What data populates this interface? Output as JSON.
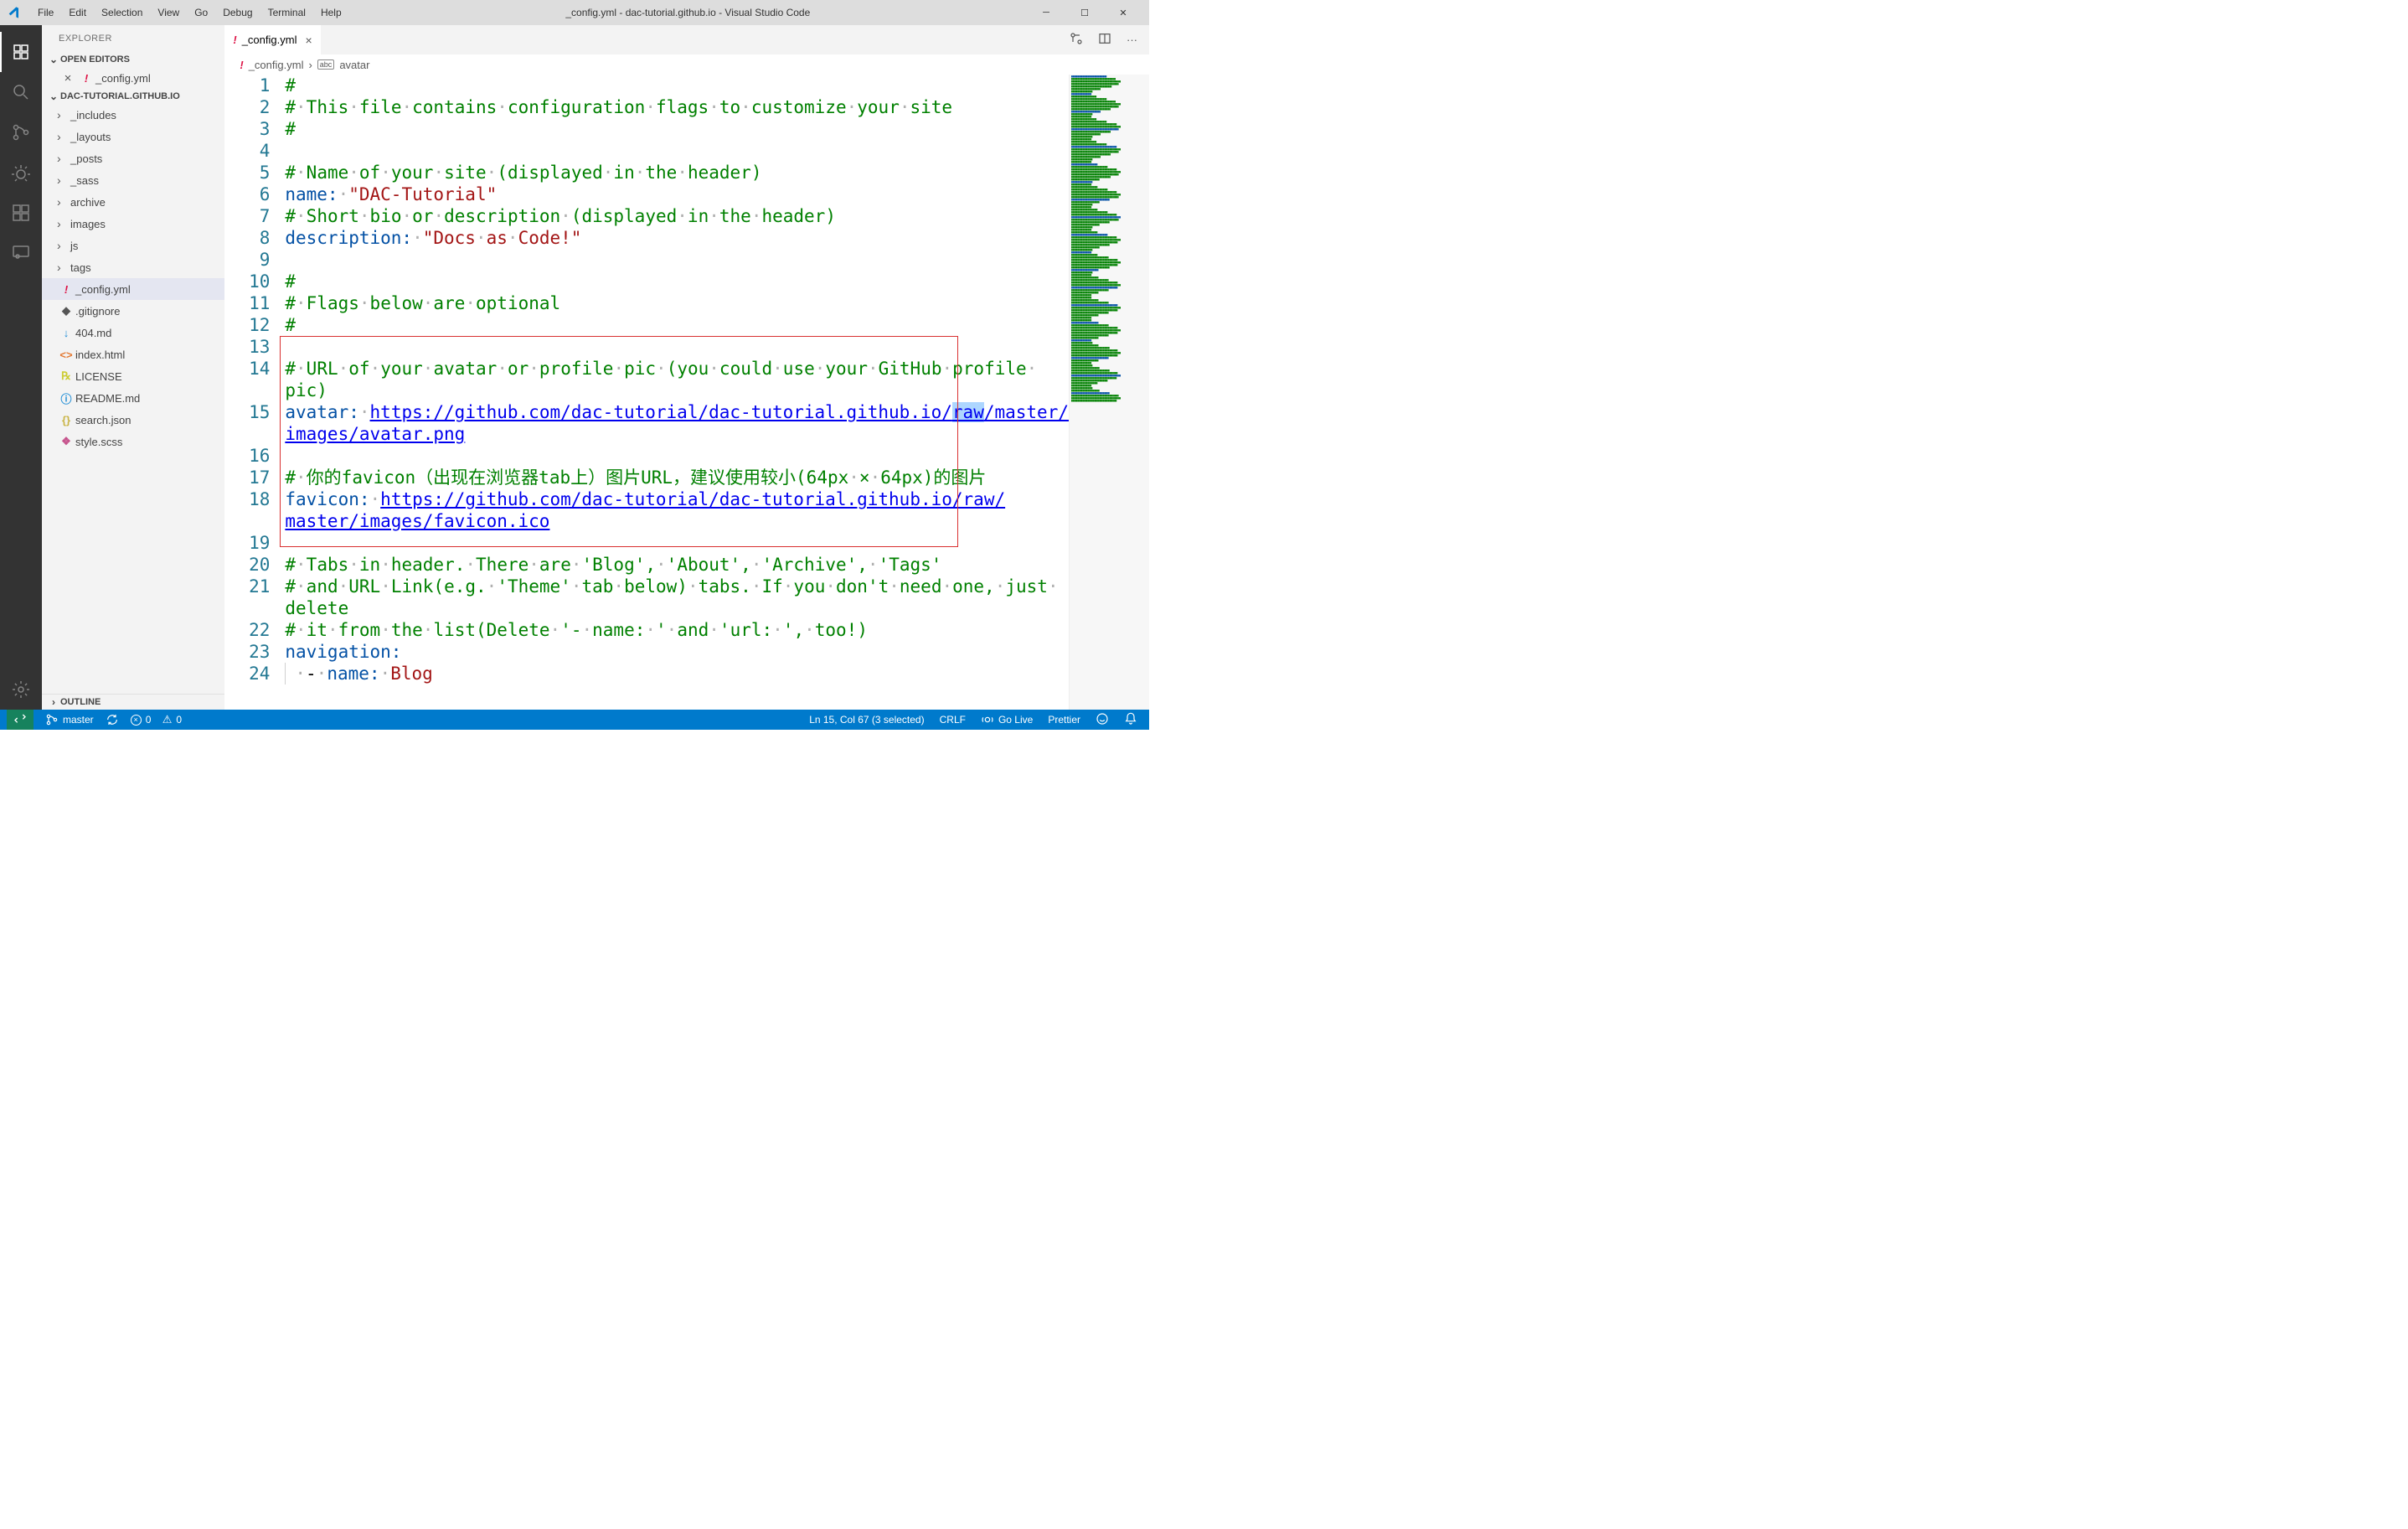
{
  "titlebar": {
    "menus": [
      "File",
      "Edit",
      "Selection",
      "View",
      "Go",
      "Debug",
      "Terminal",
      "Help"
    ],
    "title": "_config.yml - dac-tutorial.github.io - Visual Studio Code"
  },
  "sidebar": {
    "title": "EXPLORER",
    "open_editors_label": "OPEN EDITORS",
    "open_editors": [
      {
        "name": "_config.yml"
      }
    ],
    "workspace_label": "DAC-TUTORIAL.GITHUB.IO",
    "folders": [
      "_includes",
      "_layouts",
      "_posts",
      "_sass",
      "archive",
      "images",
      "js",
      "tags"
    ],
    "files": [
      {
        "name": "_config.yml",
        "icon": "!",
        "color": "#d14",
        "selected": true
      },
      {
        "name": ".gitignore",
        "icon": "◆",
        "color": "#555"
      },
      {
        "name": "404.md",
        "icon": "↓",
        "color": "#1f8dd6"
      },
      {
        "name": "index.html",
        "icon": "<>",
        "color": "#e37933"
      },
      {
        "name": "LICENSE",
        "icon": "℞",
        "color": "#cccc33"
      },
      {
        "name": "README.md",
        "icon": "ⓘ",
        "color": "#1f8dd6"
      },
      {
        "name": "search.json",
        "icon": "{}",
        "color": "#c9b445"
      },
      {
        "name": "style.scss",
        "icon": "❖",
        "color": "#c6538c"
      }
    ],
    "outline_label": "OUTLINE"
  },
  "tab": {
    "name": "_config.yml"
  },
  "breadcrumb": {
    "file": "_config.yml",
    "symbol": "avatar"
  },
  "code": {
    "lines": [
      {
        "n": 1,
        "spans": [
          {
            "c": "cm-comment",
            "t": "#"
          }
        ]
      },
      {
        "n": 2,
        "spans": [
          {
            "c": "cm-comment",
            "t": "#"
          },
          {
            "c": "cm-ws",
            "t": "·"
          },
          {
            "c": "cm-comment",
            "t": "This"
          },
          {
            "c": "cm-ws",
            "t": "·"
          },
          {
            "c": "cm-comment",
            "t": "file"
          },
          {
            "c": "cm-ws",
            "t": "·"
          },
          {
            "c": "cm-comment",
            "t": "contains"
          },
          {
            "c": "cm-ws",
            "t": "·"
          },
          {
            "c": "cm-comment",
            "t": "configuration"
          },
          {
            "c": "cm-ws",
            "t": "·"
          },
          {
            "c": "cm-comment",
            "t": "flags"
          },
          {
            "c": "cm-ws",
            "t": "·"
          },
          {
            "c": "cm-comment",
            "t": "to"
          },
          {
            "c": "cm-ws",
            "t": "·"
          },
          {
            "c": "cm-comment",
            "t": "customize"
          },
          {
            "c": "cm-ws",
            "t": "·"
          },
          {
            "c": "cm-comment",
            "t": "your"
          },
          {
            "c": "cm-ws",
            "t": "·"
          },
          {
            "c": "cm-comment",
            "t": "site"
          }
        ]
      },
      {
        "n": 3,
        "spans": [
          {
            "c": "cm-comment",
            "t": "#"
          }
        ]
      },
      {
        "n": 4,
        "spans": []
      },
      {
        "n": 5,
        "spans": [
          {
            "c": "cm-comment",
            "t": "#"
          },
          {
            "c": "cm-ws",
            "t": "·"
          },
          {
            "c": "cm-comment",
            "t": "Name"
          },
          {
            "c": "cm-ws",
            "t": "·"
          },
          {
            "c": "cm-comment",
            "t": "of"
          },
          {
            "c": "cm-ws",
            "t": "·"
          },
          {
            "c": "cm-comment",
            "t": "your"
          },
          {
            "c": "cm-ws",
            "t": "·"
          },
          {
            "c": "cm-comment",
            "t": "site"
          },
          {
            "c": "cm-ws",
            "t": "·"
          },
          {
            "c": "cm-comment",
            "t": "(displayed"
          },
          {
            "c": "cm-ws",
            "t": "·"
          },
          {
            "c": "cm-comment",
            "t": "in"
          },
          {
            "c": "cm-ws",
            "t": "·"
          },
          {
            "c": "cm-comment",
            "t": "the"
          },
          {
            "c": "cm-ws",
            "t": "·"
          },
          {
            "c": "cm-comment",
            "t": "header)"
          }
        ]
      },
      {
        "n": 6,
        "spans": [
          {
            "c": "cm-key",
            "t": "name:"
          },
          {
            "c": "cm-ws",
            "t": "·"
          },
          {
            "c": "cm-str",
            "t": "\"DAC-Tutorial\""
          }
        ]
      },
      {
        "n": 7,
        "spans": [
          {
            "c": "cm-comment",
            "t": "#"
          },
          {
            "c": "cm-ws",
            "t": "·"
          },
          {
            "c": "cm-comment",
            "t": "Short"
          },
          {
            "c": "cm-ws",
            "t": "·"
          },
          {
            "c": "cm-comment",
            "t": "bio"
          },
          {
            "c": "cm-ws",
            "t": "·"
          },
          {
            "c": "cm-comment",
            "t": "or"
          },
          {
            "c": "cm-ws",
            "t": "·"
          },
          {
            "c": "cm-comment",
            "t": "description"
          },
          {
            "c": "cm-ws",
            "t": "·"
          },
          {
            "c": "cm-comment",
            "t": "(displayed"
          },
          {
            "c": "cm-ws",
            "t": "·"
          },
          {
            "c": "cm-comment",
            "t": "in"
          },
          {
            "c": "cm-ws",
            "t": "·"
          },
          {
            "c": "cm-comment",
            "t": "the"
          },
          {
            "c": "cm-ws",
            "t": "·"
          },
          {
            "c": "cm-comment",
            "t": "header)"
          }
        ]
      },
      {
        "n": 8,
        "spans": [
          {
            "c": "cm-key",
            "t": "description:"
          },
          {
            "c": "cm-ws",
            "t": "·"
          },
          {
            "c": "cm-str",
            "t": "\"Docs"
          },
          {
            "c": "cm-ws",
            "t": "·"
          },
          {
            "c": "cm-str",
            "t": "as"
          },
          {
            "c": "cm-ws",
            "t": "·"
          },
          {
            "c": "cm-str",
            "t": "Code!\""
          }
        ]
      },
      {
        "n": 9,
        "spans": []
      },
      {
        "n": 10,
        "spans": [
          {
            "c": "cm-comment",
            "t": "#"
          }
        ]
      },
      {
        "n": 11,
        "spans": [
          {
            "c": "cm-comment",
            "t": "#"
          },
          {
            "c": "cm-ws",
            "t": "·"
          },
          {
            "c": "cm-comment",
            "t": "Flags"
          },
          {
            "c": "cm-ws",
            "t": "·"
          },
          {
            "c": "cm-comment",
            "t": "below"
          },
          {
            "c": "cm-ws",
            "t": "·"
          },
          {
            "c": "cm-comment",
            "t": "are"
          },
          {
            "c": "cm-ws",
            "t": "·"
          },
          {
            "c": "cm-comment",
            "t": "optional"
          }
        ]
      },
      {
        "n": 12,
        "spans": [
          {
            "c": "cm-comment",
            "t": "#"
          }
        ]
      },
      {
        "n": 13,
        "spans": []
      },
      {
        "n": 14,
        "spans": [
          {
            "c": "cm-comment",
            "t": "#"
          },
          {
            "c": "cm-ws",
            "t": "·"
          },
          {
            "c": "cm-comment",
            "t": "URL"
          },
          {
            "c": "cm-ws",
            "t": "·"
          },
          {
            "c": "cm-comment",
            "t": "of"
          },
          {
            "c": "cm-ws",
            "t": "·"
          },
          {
            "c": "cm-comment",
            "t": "your"
          },
          {
            "c": "cm-ws",
            "t": "·"
          },
          {
            "c": "cm-comment",
            "t": "avatar"
          },
          {
            "c": "cm-ws",
            "t": "·"
          },
          {
            "c": "cm-comment",
            "t": "or"
          },
          {
            "c": "cm-ws",
            "t": "·"
          },
          {
            "c": "cm-comment",
            "t": "profile"
          },
          {
            "c": "cm-ws",
            "t": "·"
          },
          {
            "c": "cm-comment",
            "t": "pic"
          },
          {
            "c": "cm-ws",
            "t": "·"
          },
          {
            "c": "cm-comment",
            "t": "(you"
          },
          {
            "c": "cm-ws",
            "t": "·"
          },
          {
            "c": "cm-comment",
            "t": "could"
          },
          {
            "c": "cm-ws",
            "t": "·"
          },
          {
            "c": "cm-comment",
            "t": "use"
          },
          {
            "c": "cm-ws",
            "t": "·"
          },
          {
            "c": "cm-comment",
            "t": "your"
          },
          {
            "c": "cm-ws",
            "t": "·"
          },
          {
            "c": "cm-comment",
            "t": "GitHub"
          },
          {
            "c": "cm-ws",
            "t": "·"
          },
          {
            "c": "cm-comment",
            "t": "profile"
          },
          {
            "c": "cm-ws",
            "t": "·"
          }
        ]
      },
      {
        "n": "",
        "spans": [
          {
            "c": "cm-comment",
            "t": "pic)"
          }
        ]
      },
      {
        "n": 15,
        "spans": [
          {
            "c": "cm-key",
            "t": "avatar:"
          },
          {
            "c": "cm-ws",
            "t": "·"
          },
          {
            "c": "cm-link",
            "t": "https://github.com/dac-tutorial/dac-tutorial.github.io/"
          },
          {
            "c": "cm-link cm-sel",
            "t": "raw"
          },
          {
            "c": "cm-link",
            "t": "/master/"
          }
        ]
      },
      {
        "n": "",
        "spans": [
          {
            "c": "cm-link",
            "t": "images/avatar.png"
          }
        ]
      },
      {
        "n": 16,
        "spans": []
      },
      {
        "n": 17,
        "spans": [
          {
            "c": "cm-comment",
            "t": "#"
          },
          {
            "c": "cm-ws",
            "t": "·"
          },
          {
            "c": "cm-comment",
            "t": "你的favicon（出现在浏览器tab上）图片URL，建议使用较小(64px"
          },
          {
            "c": "cm-ws",
            "t": "·"
          },
          {
            "c": "cm-comment",
            "t": "×"
          },
          {
            "c": "cm-ws",
            "t": "·"
          },
          {
            "c": "cm-comment",
            "t": "64px)的图片"
          }
        ]
      },
      {
        "n": 18,
        "spans": [
          {
            "c": "cm-key",
            "t": "favicon:"
          },
          {
            "c": "cm-ws",
            "t": "·"
          },
          {
            "c": "cm-link",
            "t": "https://github.com/dac-tutorial/dac-tutorial.github.io/raw/"
          }
        ]
      },
      {
        "n": "",
        "spans": [
          {
            "c": "cm-link",
            "t": "master/images/favicon.ico"
          }
        ]
      },
      {
        "n": 19,
        "spans": []
      },
      {
        "n": 20,
        "spans": [
          {
            "c": "cm-comment",
            "t": "#"
          },
          {
            "c": "cm-ws",
            "t": "·"
          },
          {
            "c": "cm-comment",
            "t": "Tabs"
          },
          {
            "c": "cm-ws",
            "t": "·"
          },
          {
            "c": "cm-comment",
            "t": "in"
          },
          {
            "c": "cm-ws",
            "t": "·"
          },
          {
            "c": "cm-comment",
            "t": "header."
          },
          {
            "c": "cm-ws",
            "t": "·"
          },
          {
            "c": "cm-comment",
            "t": "There"
          },
          {
            "c": "cm-ws",
            "t": "·"
          },
          {
            "c": "cm-comment",
            "t": "are"
          },
          {
            "c": "cm-ws",
            "t": "·"
          },
          {
            "c": "cm-comment",
            "t": "'Blog',"
          },
          {
            "c": "cm-ws",
            "t": "·"
          },
          {
            "c": "cm-comment",
            "t": "'About',"
          },
          {
            "c": "cm-ws",
            "t": "·"
          },
          {
            "c": "cm-comment",
            "t": "'Archive',"
          },
          {
            "c": "cm-ws",
            "t": "·"
          },
          {
            "c": "cm-comment",
            "t": "'Tags'"
          }
        ]
      },
      {
        "n": 21,
        "spans": [
          {
            "c": "cm-comment",
            "t": "#"
          },
          {
            "c": "cm-ws",
            "t": "·"
          },
          {
            "c": "cm-comment",
            "t": "and"
          },
          {
            "c": "cm-ws",
            "t": "·"
          },
          {
            "c": "cm-comment",
            "t": "URL"
          },
          {
            "c": "cm-ws",
            "t": "·"
          },
          {
            "c": "cm-comment",
            "t": "Link(e.g."
          },
          {
            "c": "cm-ws",
            "t": "·"
          },
          {
            "c": "cm-comment",
            "t": "'Theme'"
          },
          {
            "c": "cm-ws",
            "t": "·"
          },
          {
            "c": "cm-comment",
            "t": "tab"
          },
          {
            "c": "cm-ws",
            "t": "·"
          },
          {
            "c": "cm-comment",
            "t": "below)"
          },
          {
            "c": "cm-ws",
            "t": "·"
          },
          {
            "c": "cm-comment",
            "t": "tabs."
          },
          {
            "c": "cm-ws",
            "t": "·"
          },
          {
            "c": "cm-comment",
            "t": "If"
          },
          {
            "c": "cm-ws",
            "t": "·"
          },
          {
            "c": "cm-comment",
            "t": "you"
          },
          {
            "c": "cm-ws",
            "t": "·"
          },
          {
            "c": "cm-comment",
            "t": "don't"
          },
          {
            "c": "cm-ws",
            "t": "·"
          },
          {
            "c": "cm-comment",
            "t": "need"
          },
          {
            "c": "cm-ws",
            "t": "·"
          },
          {
            "c": "cm-comment",
            "t": "one,"
          },
          {
            "c": "cm-ws",
            "t": "·"
          },
          {
            "c": "cm-comment",
            "t": "just"
          },
          {
            "c": "cm-ws",
            "t": "·"
          }
        ]
      },
      {
        "n": "",
        "spans": [
          {
            "c": "cm-comment",
            "t": "delete"
          }
        ]
      },
      {
        "n": 22,
        "spans": [
          {
            "c": "cm-comment",
            "t": "#"
          },
          {
            "c": "cm-ws",
            "t": "·"
          },
          {
            "c": "cm-comment",
            "t": "it"
          },
          {
            "c": "cm-ws",
            "t": "·"
          },
          {
            "c": "cm-comment",
            "t": "from"
          },
          {
            "c": "cm-ws",
            "t": "·"
          },
          {
            "c": "cm-comment",
            "t": "the"
          },
          {
            "c": "cm-ws",
            "t": "·"
          },
          {
            "c": "cm-comment",
            "t": "list(Delete"
          },
          {
            "c": "cm-ws",
            "t": "·"
          },
          {
            "c": "cm-comment",
            "t": "'-"
          },
          {
            "c": "cm-ws",
            "t": "·"
          },
          {
            "c": "cm-comment",
            "t": "name:"
          },
          {
            "c": "cm-ws",
            "t": "·"
          },
          {
            "c": "cm-comment",
            "t": "'"
          },
          {
            "c": "cm-ws",
            "t": "·"
          },
          {
            "c": "cm-comment",
            "t": "and"
          },
          {
            "c": "cm-ws",
            "t": "·"
          },
          {
            "c": "cm-comment",
            "t": "'url:"
          },
          {
            "c": "cm-ws",
            "t": "·"
          },
          {
            "c": "cm-comment",
            "t": "',"
          },
          {
            "c": "cm-ws",
            "t": "·"
          },
          {
            "c": "cm-comment",
            "t": "too!)"
          }
        ]
      },
      {
        "n": 23,
        "spans": [
          {
            "c": "cm-key",
            "t": "navigation:"
          }
        ]
      },
      {
        "n": 24,
        "guide": true,
        "spans": [
          {
            "c": "cm-ws",
            "t": "·"
          },
          {
            "c": "cm-text",
            "t": "-"
          },
          {
            "c": "cm-ws",
            "t": "·"
          },
          {
            "c": "cm-key",
            "t": "name:"
          },
          {
            "c": "cm-ws",
            "t": "·"
          },
          {
            "c": "cm-str",
            "t": "Blog"
          }
        ]
      }
    ]
  },
  "statusbar": {
    "branch": "master",
    "errors": "0",
    "warnings": "0",
    "cursor": "Ln 15, Col 67 (3 selected)",
    "eol": "CRLF",
    "golive": "Go Live",
    "formatter": "Prettier"
  }
}
